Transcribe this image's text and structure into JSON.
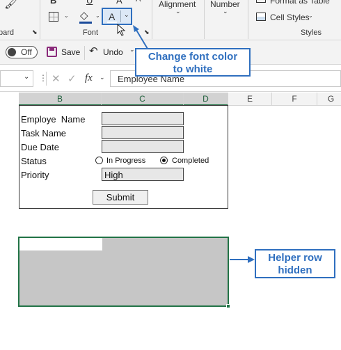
{
  "ribbon": {
    "clipboard_label": "pard",
    "font_group_label": "Font",
    "alignment_label": "Alignment",
    "number_label": "Number",
    "format_as_table_label": "Format as Table",
    "cell_styles_label": "Cell Styles",
    "styles_group_label": "Styles",
    "font_color_letter": "A"
  },
  "qat": {
    "autosave_state": "Off",
    "save_label": "Save",
    "undo_label": "Undo"
  },
  "formula_bar": {
    "cancel_glyph": "✕",
    "enter_glyph": "✓",
    "fx_label": "fx",
    "value": "Employee Name"
  },
  "columns": [
    "B",
    "C",
    "D",
    "E",
    "F",
    "G"
  ],
  "form": {
    "fields": [
      {
        "label": "Employe  Name",
        "value": ""
      },
      {
        "label": "Task Name",
        "value": ""
      },
      {
        "label": "Due Date",
        "value": ""
      }
    ],
    "status_label": "Status",
    "status_options": [
      {
        "label": "In Progress",
        "selected": false
      },
      {
        "label": "Completed",
        "selected": true
      }
    ],
    "priority_label": "Priority",
    "priority_value": "High",
    "submit_label": "Submit"
  },
  "callouts": {
    "font_color": "Change font color to white",
    "helper_row": "Helper row hidden"
  },
  "colors": {
    "accent_green": "#217346",
    "callout_blue": "#2f6fbf"
  }
}
